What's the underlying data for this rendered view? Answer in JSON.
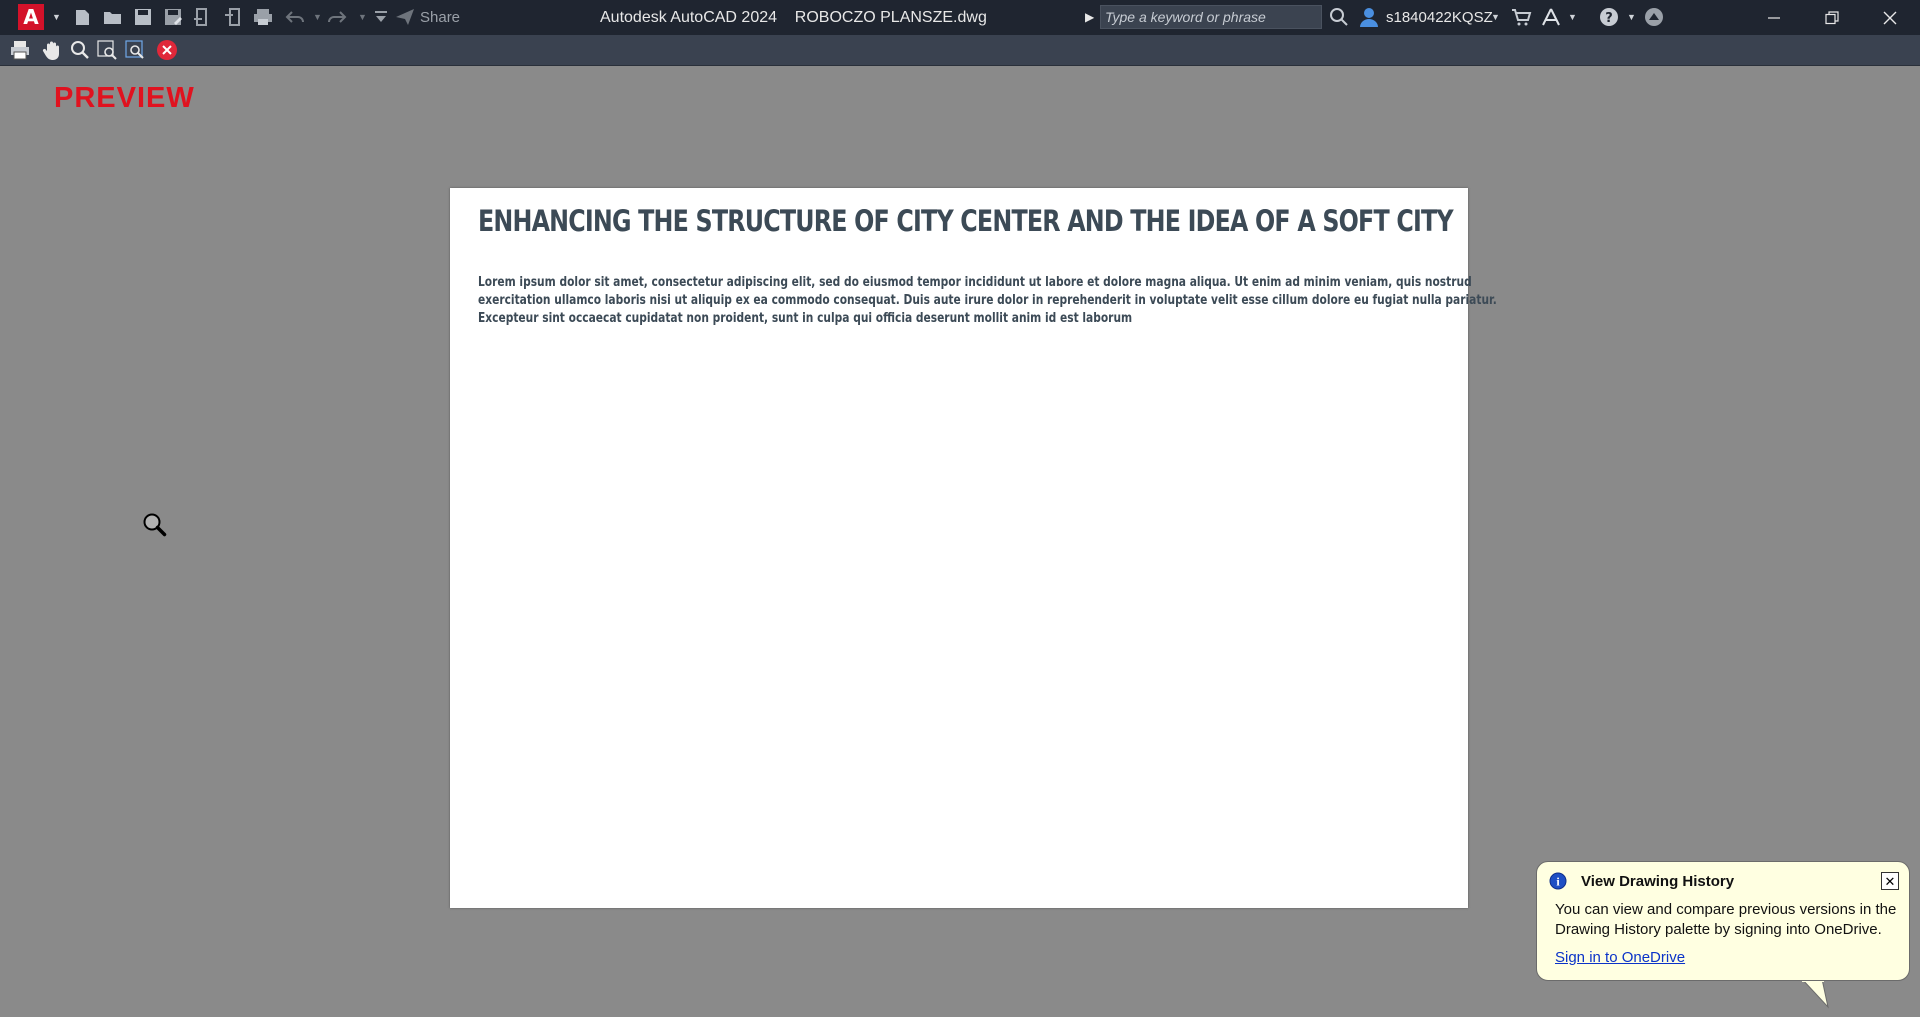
{
  "titlebar": {
    "app_logo_letter": "A",
    "share_label": "Share",
    "window_title": "Autodesk AutoCAD 2024    ROBOCZO PLANSZE.dwg",
    "search_placeholder": "Type a keyword or phrase",
    "user_name": "s1840422KQSZ"
  },
  "preview_label": "PREVIEW",
  "sheet": {
    "title": "ENHANCING THE STRUCTURE OF CITY CENTER AND THE IDEA OF A SOFT CITY",
    "body_lines": [
      "Lorem ipsum dolor sit amet, consectetur adipiscing elit, sed do eiusmod tempor incididunt ut labore et dolore magna aliqua. Ut enim ad minim veniam, quis nostrud",
      "exercitation ullamco laboris nisi ut aliquip ex ea commodo consequat. Duis aute irure dolor in reprehenderit in voluptate velit esse cillum dolore eu fugiat nulla pariatur.",
      "Excepteur sint occaecat cupidatat non proident, sunt in culpa qui officia deserunt mollit anim id est laborum"
    ]
  },
  "balloon": {
    "title": "View Drawing History",
    "text": "You can view and compare previous versions in the Drawing History palette by signing into OneDrive.",
    "link": "Sign in to OneDrive",
    "close_glyph": "✕"
  },
  "colors": {
    "accent": "#d3122a",
    "preview_red": "#e0121f",
    "titlebar_bg": "#1f2530",
    "toolbar_bg": "#3a4250",
    "canvas_bg": "#8a8a8a",
    "sheet_text": "#3c4a56",
    "balloon_bg": "#ffffe1"
  }
}
